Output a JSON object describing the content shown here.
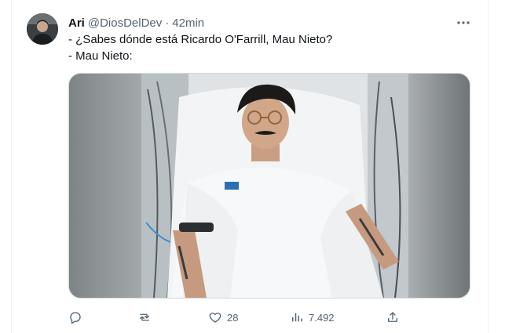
{
  "tweet": {
    "display_name": "Ari",
    "handle": "@DiosDelDev",
    "separator": "·",
    "time": "42min",
    "text_lines": [
      "- ¿Sabes dónde está Ricardo O'Farrill, Mau Nieto?",
      "- Mau Nieto:"
    ]
  },
  "icons": {
    "more": "more-icon",
    "reply": "reply-icon",
    "retweet": "retweet-icon",
    "like": "heart-icon",
    "views": "views-icon",
    "share": "share-icon"
  },
  "actions": {
    "reply_count": "",
    "retweet_count": "",
    "like_count": "28",
    "views_count": "7.492"
  },
  "colors": {
    "text": "#0f1419",
    "secondary": "#536471",
    "border": "#cfd9de"
  }
}
